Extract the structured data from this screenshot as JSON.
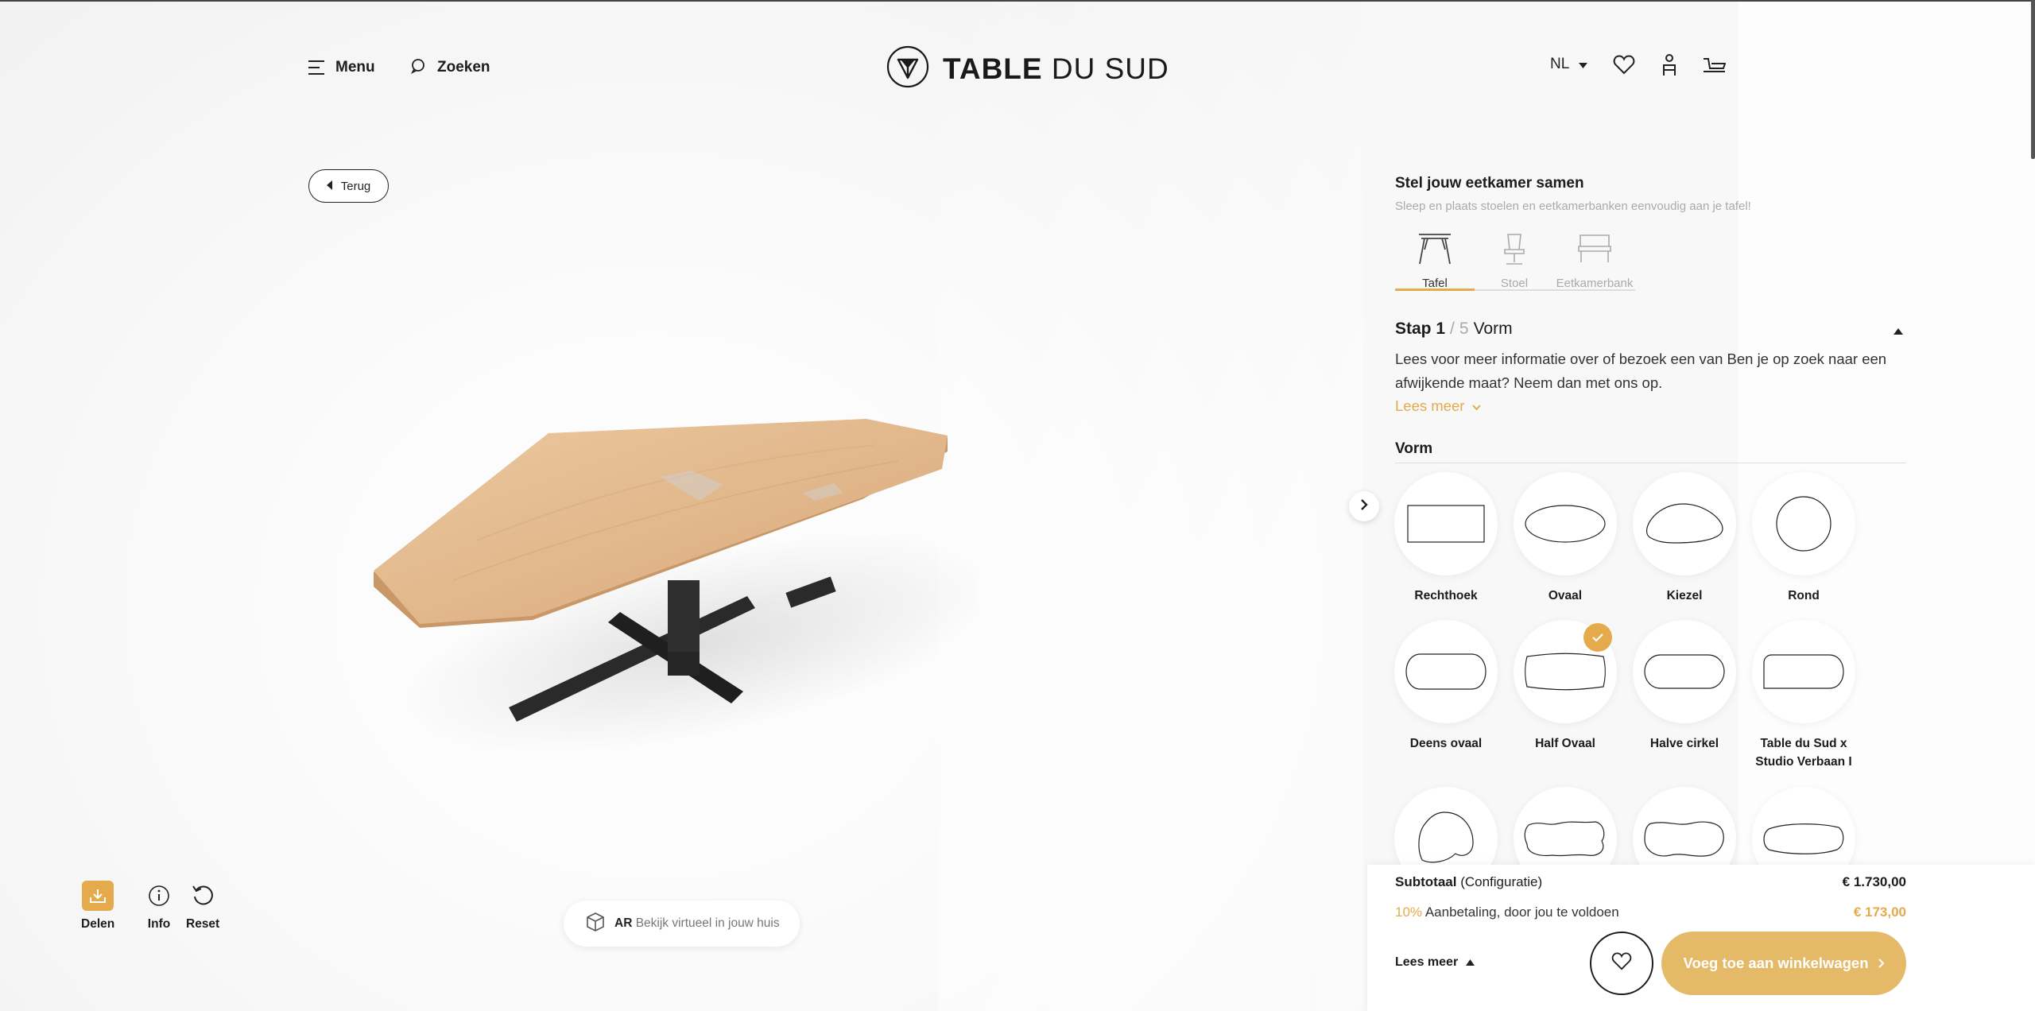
{
  "header": {
    "menu_label": "Menu",
    "search_label": "Zoeken",
    "logo_bold": "TABLE",
    "logo_light": "DU SUD",
    "language": "NL"
  },
  "viewer": {
    "back_label": "Terug",
    "tools": {
      "share": "Delen",
      "info": "Info",
      "reset": "Reset"
    },
    "ar": {
      "prefix": "AR",
      "text": "Bekijk virtueel in jouw huis"
    }
  },
  "configurator": {
    "title": "Stel jouw eetkamer samen",
    "subtitle": "Sleep en plaats stoelen en eetkamerbanken eenvoudig aan je tafel!",
    "categories": [
      {
        "label": "Tafel",
        "active": true
      },
      {
        "label": "Stoel",
        "active": false
      },
      {
        "label": "Eetkamerbank",
        "active": false
      }
    ],
    "step": {
      "prefix": "Stap 1",
      "sep": "/",
      "total": "5",
      "name": "Vorm"
    },
    "description": "Lees voor meer informatie over of bezoek een van Ben je op zoek naar een afwijkende maat? Neem dan met ons op.",
    "read_more": "Lees meer",
    "section_title": "Vorm",
    "shapes": [
      {
        "label": "Rechthoek",
        "icon": "rectangle-shape-icon"
      },
      {
        "label": "Ovaal",
        "icon": "oval-shape-icon"
      },
      {
        "label": "Kiezel",
        "icon": "pebble-shape-icon"
      },
      {
        "label": "Rond",
        "icon": "round-shape-icon"
      },
      {
        "label": "Deens ovaal",
        "icon": "danish-oval-shape-icon"
      },
      {
        "label": "Half Ovaal",
        "icon": "half-oval-shape-icon",
        "selected": true
      },
      {
        "label": "Halve cirkel",
        "icon": "half-circle-shape-icon"
      },
      {
        "label": "Table du Sud x Studio Verbaan I",
        "icon": "studio-verbaan-shape-icon"
      },
      {
        "label": "",
        "icon": "drop-shape-icon"
      },
      {
        "label": "",
        "icon": "organic-shape-icon"
      },
      {
        "label": "",
        "icon": "organic-shape-2-icon"
      },
      {
        "label": "",
        "icon": "organic-oval-shape-icon"
      }
    ]
  },
  "summary": {
    "subtotal_label": "Subtotaal",
    "subtotal_note": "(Configuratie)",
    "subtotal_value": "€ 1.730,00",
    "deposit_pct": "10%",
    "deposit_label": "Aanbetaling, door jou te voldoen",
    "deposit_value": "€ 173,00",
    "read_more": "Lees meer",
    "cart_button": "Voeg toe aan winkelwagen"
  },
  "colors": {
    "accent": "#e4aa4c",
    "cart": "#e4b968"
  }
}
